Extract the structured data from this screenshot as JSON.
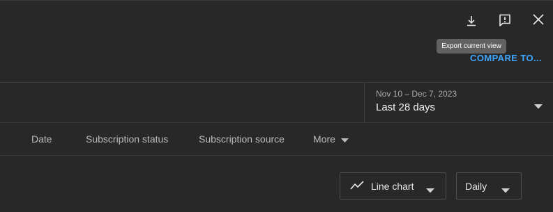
{
  "toolbar": {
    "download_icon": "download-icon",
    "feedback_icon": "feedback-icon",
    "close_icon": "close-icon"
  },
  "tooltip": {
    "text": "Export current view"
  },
  "compare": {
    "label": "COMPARE TO..."
  },
  "date_picker": {
    "range": "Nov 10 – Dec 7, 2023",
    "preset": "Last 28 days"
  },
  "tabs": [
    {
      "label": "Date"
    },
    {
      "label": "Subscription status"
    },
    {
      "label": "Subscription source"
    },
    {
      "label": "More"
    }
  ],
  "chart_controls": {
    "chart_type": "Line chart",
    "interval": "Daily"
  },
  "colors": {
    "background": "#282828",
    "link": "#3ea6ff",
    "tooltip_bg": "#616161"
  }
}
